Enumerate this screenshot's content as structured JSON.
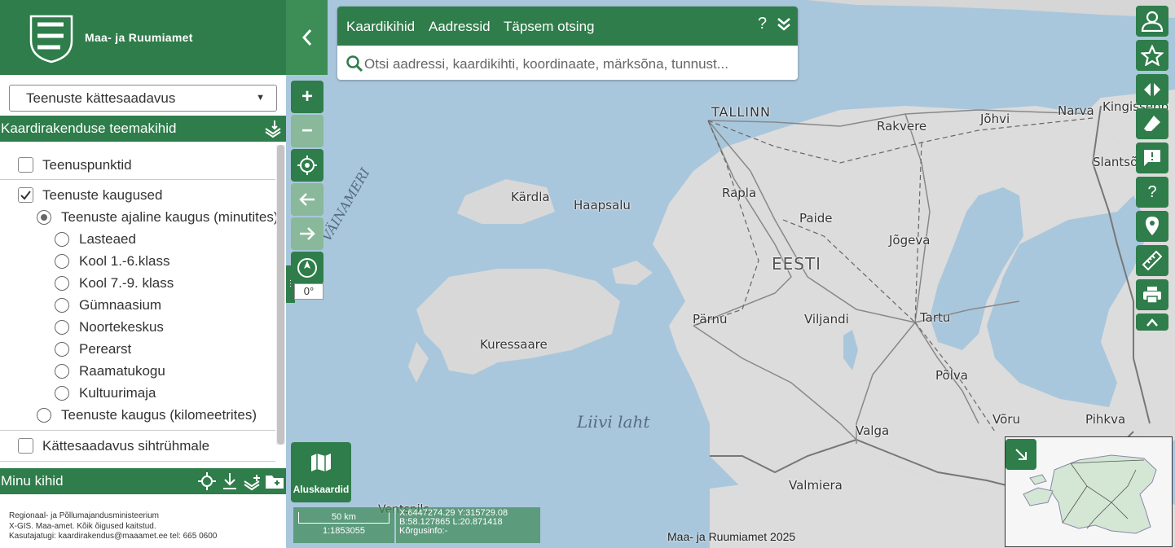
{
  "header": {
    "logo_text": "Maa- ja Ruumiamet",
    "collapse_icon": "‹"
  },
  "sidebar": {
    "service_select": {
      "selected": "Teenuste kättesaadavus"
    },
    "theme_section_title": "Kaardirakenduse teemakihid",
    "layers": [
      {
        "label": "Teenuspunktid",
        "type": "checkbox",
        "checked": false
      },
      {
        "label": "Teenuste kaugused",
        "type": "checkbox",
        "checked": true
      },
      {
        "label": "Teenuste ajaline kaugus (minutites)",
        "type": "radio",
        "checked": true
      },
      {
        "label": "Lasteaed",
        "type": "radio",
        "checked": false
      },
      {
        "label": "Kool 1.-6.klass",
        "type": "radio",
        "checked": false
      },
      {
        "label": "Kool 7.-9. klass",
        "type": "radio",
        "checked": false
      },
      {
        "label": "Gümnaasium",
        "type": "radio",
        "checked": false
      },
      {
        "label": "Noortekeskus",
        "type": "radio",
        "checked": false
      },
      {
        "label": "Perearst",
        "type": "radio",
        "checked": false
      },
      {
        "label": "Raamatukogu",
        "type": "radio",
        "checked": false
      },
      {
        "label": "Kultuurimaja",
        "type": "radio",
        "checked": false
      },
      {
        "label": "Teenuste kaugus (kilomeetrites)",
        "type": "radio",
        "checked": false
      },
      {
        "label": "Kättesaadavus sihtrühmale",
        "type": "checkbox",
        "checked": false
      }
    ],
    "my_layers_title": "Minu kihid",
    "footer": {
      "line1": "Regionaal- ja Põllumajandusministeerium",
      "line2": "X-GIS. Maa-amet. Kõik õigused kaitstud.",
      "line3": "Kasutajatugi: kaardirakendus@maaamet.ee tel: 665 0600"
    }
  },
  "search": {
    "tabs": [
      "Kaardikihid",
      "Aadressid",
      "Täpsem otsing"
    ],
    "help_label": "?",
    "placeholder": "Otsi aadressi, kaardikihti, koordinaate, märksõna, tunnust..."
  },
  "map_controls": {
    "zoom_in": "+",
    "zoom_out": "−",
    "rotation": "0°"
  },
  "basemap_button": {
    "label": "Aluskaardid"
  },
  "scale": {
    "distance": "50 km",
    "ratio": "1:1853055"
  },
  "coordinates": {
    "xy": "X:6447274.29 Y:315729.08",
    "bl": "B:58.127865 L:20.871418",
    "height": "Kõrgusinfo:-"
  },
  "attribution": "Maa- ja Ruumiamet 2025",
  "map_labels": {
    "cities": [
      "TALLINN",
      "Narva",
      "Kingissepp",
      "Jõhvi",
      "Rakvere",
      "Slantsõ",
      "Kärdla",
      "Haapsalu",
      "Rapla",
      "Paide",
      "Jõgeva",
      "EESTI",
      "Pärnu",
      "Viljandi",
      "Tartu",
      "Kuressaare",
      "Põlva",
      "Valga",
      "Võru",
      "Pihkva",
      "Valmiera",
      "Ventspils"
    ],
    "seas": [
      "Liivi laht",
      "VÄINAMERI"
    ]
  },
  "colors": {
    "brand_green": "#2e7d4a",
    "sea": "#a9c7dc",
    "land": "#dcdcdc"
  }
}
